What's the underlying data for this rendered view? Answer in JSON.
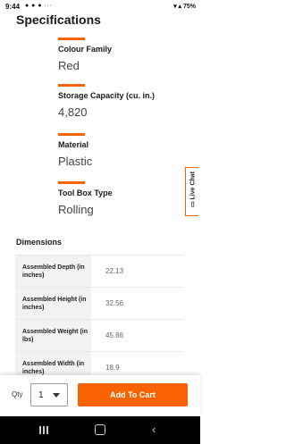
{
  "status": {
    "time": "9:44",
    "left_icons": "● ● ● ···",
    "battery": "75%"
  },
  "page": {
    "title": "Specifications"
  },
  "specs": [
    {
      "label": "Colour Family",
      "value": "Red"
    },
    {
      "label": "Storage Capacity (cu. in.)",
      "value": "4,820"
    },
    {
      "label": "Material",
      "value": "Plastic"
    },
    {
      "label": "Tool Box Type",
      "value": "Rolling"
    }
  ],
  "live_chat": {
    "label": "Live Chat",
    "icon": "chat-icon"
  },
  "dimensions": {
    "title": "Dimensions",
    "rows": [
      {
        "key": "Assembled Depth (in inches)",
        "value": "22.13"
      },
      {
        "key": "Assembled Height (in inches)",
        "value": "32.56"
      },
      {
        "key": "Assembled Weight (in lbs)",
        "value": "45.86"
      },
      {
        "key": "Assembled Width (in inches)",
        "value": "18.9"
      }
    ]
  },
  "cart_bar": {
    "qty_label": "Qty",
    "qty_value": "1",
    "add_to_cart": "Add To Cart"
  },
  "colors": {
    "accent": "#f96302"
  }
}
